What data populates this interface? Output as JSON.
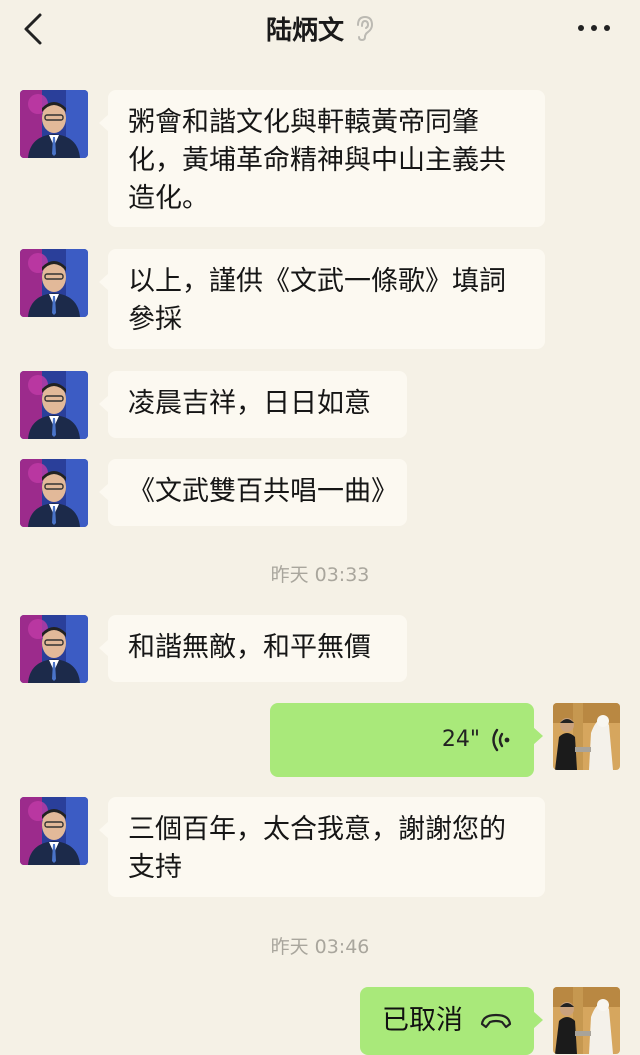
{
  "header": {
    "title": "陆炳文",
    "back_icon": "chevron-left-icon",
    "ear_icon": "ear-icon",
    "more_icon": "more-dots-icon"
  },
  "messages": [
    {
      "side": "left",
      "text": "粥會和諧文化與軒轅黃帝同肇化，黃埔革命精神與中山主義共造化。"
    },
    {
      "side": "left",
      "text": "以上，謹供《文武一條歌》填詞參採"
    },
    {
      "side": "left",
      "text": "凌晨吉祥，日日如意"
    },
    {
      "side": "left",
      "text": "《文武雙百共唱一曲》"
    },
    {
      "type": "time",
      "text": "昨天 03:33"
    },
    {
      "side": "left",
      "text": "和諧無敵，和平無價"
    },
    {
      "side": "right",
      "type": "voice",
      "duration": "24\""
    },
    {
      "side": "left",
      "text": "三個百年，太合我意，謝謝您的支持"
    },
    {
      "type": "time",
      "text": "昨天 03:46"
    },
    {
      "side": "right",
      "type": "call",
      "text": "已取消",
      "icon": "phone-hangup-icon"
    }
  ],
  "colors": {
    "background": "#f5f1e6",
    "bubble_white": "#fcf9f1",
    "bubble_green": "#a9e97a",
    "timestamp": "#a9a69d"
  }
}
